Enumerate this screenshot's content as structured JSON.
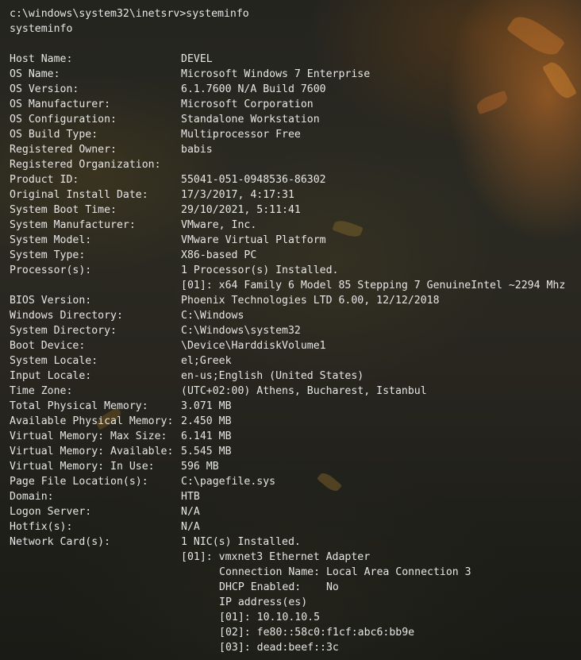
{
  "prompt_line": "c:\\windows\\system32\\inetsrv>systeminfo",
  "echo_line": "systeminfo",
  "rows": [
    {
      "key": "Host Name:",
      "value": "DEVEL"
    },
    {
      "key": "OS Name:",
      "value": "Microsoft Windows 7 Enterprise"
    },
    {
      "key": "OS Version:",
      "value": "6.1.7600 N/A Build 7600"
    },
    {
      "key": "OS Manufacturer:",
      "value": "Microsoft Corporation"
    },
    {
      "key": "OS Configuration:",
      "value": "Standalone Workstation"
    },
    {
      "key": "OS Build Type:",
      "value": "Multiprocessor Free"
    },
    {
      "key": "Registered Owner:",
      "value": "babis"
    },
    {
      "key": "Registered Organization:",
      "value": ""
    },
    {
      "key": "Product ID:",
      "value": "55041-051-0948536-86302"
    },
    {
      "key": "Original Install Date:",
      "value": "17/3/2017, 4:17:31"
    },
    {
      "key": "System Boot Time:",
      "value": "29/10/2021, 5:11:41"
    },
    {
      "key": "System Manufacturer:",
      "value": "VMware, Inc."
    },
    {
      "key": "System Model:",
      "value": "VMware Virtual Platform"
    },
    {
      "key": "System Type:",
      "value": "X86-based PC"
    },
    {
      "key": "Processor(s):",
      "value": "1 Processor(s) Installed."
    }
  ],
  "processor_detail": "[01]: x64 Family 6 Model 85 Stepping 7 GenuineIntel ~2294 Mhz",
  "rows2": [
    {
      "key": "BIOS Version:",
      "value": "Phoenix Technologies LTD 6.00, 12/12/2018"
    },
    {
      "key": "Windows Directory:",
      "value": "C:\\Windows"
    },
    {
      "key": "System Directory:",
      "value": "C:\\Windows\\system32"
    },
    {
      "key": "Boot Device:",
      "value": "\\Device\\HarddiskVolume1"
    },
    {
      "key": "System Locale:",
      "value": "el;Greek"
    },
    {
      "key": "Input Locale:",
      "value": "en-us;English (United States)"
    },
    {
      "key": "Time Zone:",
      "value": "(UTC+02:00) Athens, Bucharest, Istanbul"
    },
    {
      "key": "Total Physical Memory:",
      "value": "3.071 MB"
    },
    {
      "key": "Available Physical Memory:",
      "value": "2.450 MB"
    },
    {
      "key": "Virtual Memory: Max Size:",
      "value": "6.141 MB"
    },
    {
      "key": "Virtual Memory: Available:",
      "value": "5.545 MB"
    },
    {
      "key": "Virtual Memory: In Use:",
      "value": "596 MB"
    },
    {
      "key": "Page File Location(s):",
      "value": "C:\\pagefile.sys"
    },
    {
      "key": "Domain:",
      "value": "HTB"
    },
    {
      "key": "Logon Server:",
      "value": "N/A"
    },
    {
      "key": "Hotfix(s):",
      "value": "N/A"
    },
    {
      "key": "Network Card(s):",
      "value": "1 NIC(s) Installed."
    }
  ],
  "nic": {
    "adapter": "[01]: vmxnet3 Ethernet Adapter",
    "connection_name": "Connection Name: Local Area Connection 3",
    "dhcp": "DHCP Enabled:    No",
    "ip_header": "IP address(es)",
    "ips": [
      "[01]: 10.10.10.5",
      "[02]: fe80::58c0:f1cf:abc6:bb9e",
      "[03]: dead:beef::3c"
    ]
  }
}
